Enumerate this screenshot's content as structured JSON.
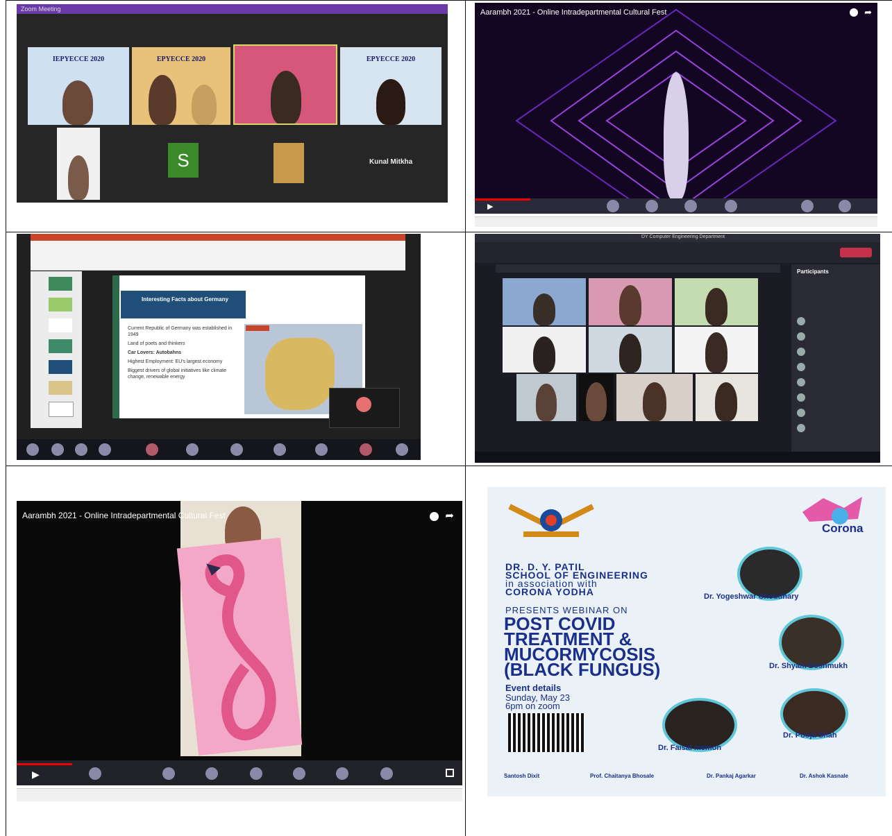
{
  "panel1": {
    "title_bar": "Zoom Meeting",
    "tile_headings": [
      "IEPYECCE 2020",
      "EPYECCE 2020",
      "EPYECCE 2020"
    ],
    "avatar_letter": "S",
    "name_tile": "Kunal Mitkha"
  },
  "panel2": {
    "video_title": "Aarambh 2021 - Online Intradepartmental Cultural Fest"
  },
  "panel3": {
    "slide_title": "Interesting Facts about Germany",
    "bullets": [
      "Current Republic of Germany was established in 1949",
      "Land of poets and thinkers",
      "Car Lovers: Autobahns",
      "Highest Employment: EU's largest economy",
      "Biggest drivers of global initiatives like climate change, renewable energy"
    ]
  },
  "panel4": {
    "window_title": "DY Computer Engineering Department",
    "participants_header": "Participants"
  },
  "panel5": {
    "video_title": "Aarambh 2021 - Online Intradepartmental Cultural Fest"
  },
  "panel6": {
    "line1": "DR. D. Y. PATIL",
    "line2": "SCHOOL OF ENGINEERING",
    "line3": "in association with",
    "line4": "CORONA YODHA",
    "presents": "PRESENTS WEBINAR ON",
    "headline1": "POST COVID",
    "headline2": "TREATMENT &",
    "headline3": "MUCORMYCOSIS",
    "headline4": "(BLACK FUNGUS)",
    "event_details": "Event details",
    "date": "Sunday, May 23",
    "time": "6pm on zoom",
    "brand": "Corona",
    "speakers": [
      {
        "name": "Dr. Yogeshwar Choudhary"
      },
      {
        "name": "Dr. Shyam Deshmukh"
      },
      {
        "name": "Dr. Faisal memon"
      },
      {
        "name": "Dr. Pooja Shah"
      }
    ],
    "footer": [
      "Santosh Dixit",
      "Prof. Chaitanya Bhosale",
      "Dr. Pankaj Agarkar",
      "Dr. Ashok Kasnale"
    ]
  },
  "colors": {
    "border": "#111111",
    "dark_bg": "#1f1f1f",
    "zoom_bg": "#262626",
    "neon_purple": "#8b2cf5",
    "slide_blue": "#1f4e79",
    "poster_blue": "#1a2f8a",
    "flamingo_pink": "#e2578a"
  }
}
